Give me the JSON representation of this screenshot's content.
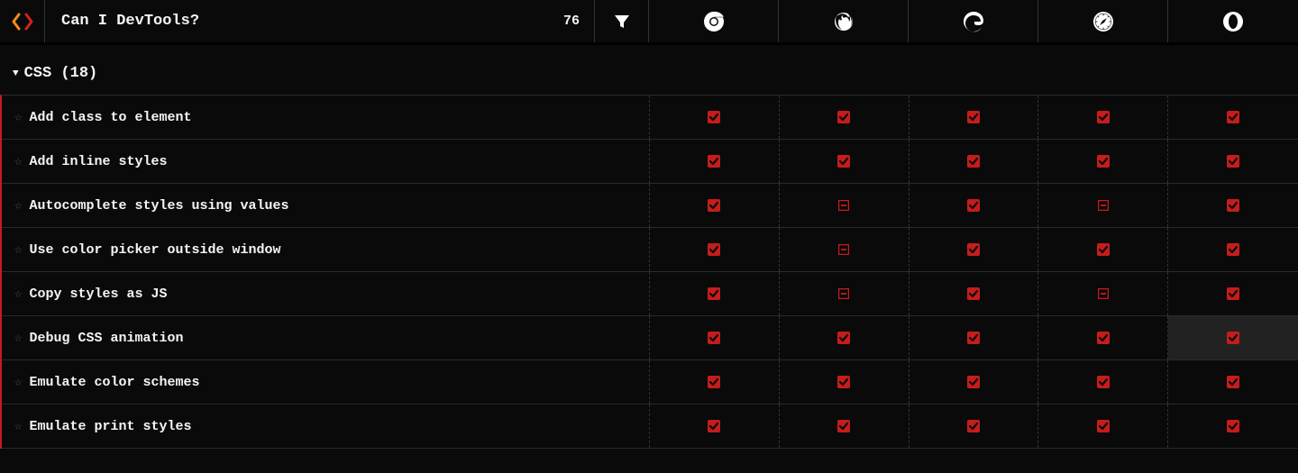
{
  "header": {
    "title": "Can I DevTools?",
    "count": "76"
  },
  "browsers": [
    "chrome",
    "firefox",
    "edge",
    "safari",
    "opera"
  ],
  "section": {
    "label": "CSS (18)"
  },
  "features": [
    {
      "name": "Add class to element",
      "support": [
        "yes",
        "yes",
        "yes",
        "yes",
        "yes"
      ]
    },
    {
      "name": "Add inline styles",
      "support": [
        "yes",
        "yes",
        "yes",
        "yes",
        "yes"
      ]
    },
    {
      "name": "Autocomplete styles using values",
      "support": [
        "yes",
        "partial",
        "yes",
        "partial",
        "yes"
      ]
    },
    {
      "name": "Use color picker outside window",
      "support": [
        "yes",
        "partial",
        "yes",
        "yes",
        "yes"
      ]
    },
    {
      "name": "Copy styles as JS",
      "support": [
        "yes",
        "partial",
        "yes",
        "partial",
        "yes"
      ]
    },
    {
      "name": "Debug CSS animation",
      "support": [
        "yes",
        "yes",
        "yes",
        "yes",
        "yes"
      ],
      "highlight": 4
    },
    {
      "name": "Emulate color schemes",
      "support": [
        "yes",
        "yes",
        "yes",
        "yes",
        "yes"
      ]
    },
    {
      "name": "Emulate print styles",
      "support": [
        "yes",
        "yes",
        "yes",
        "yes",
        "yes"
      ]
    }
  ]
}
